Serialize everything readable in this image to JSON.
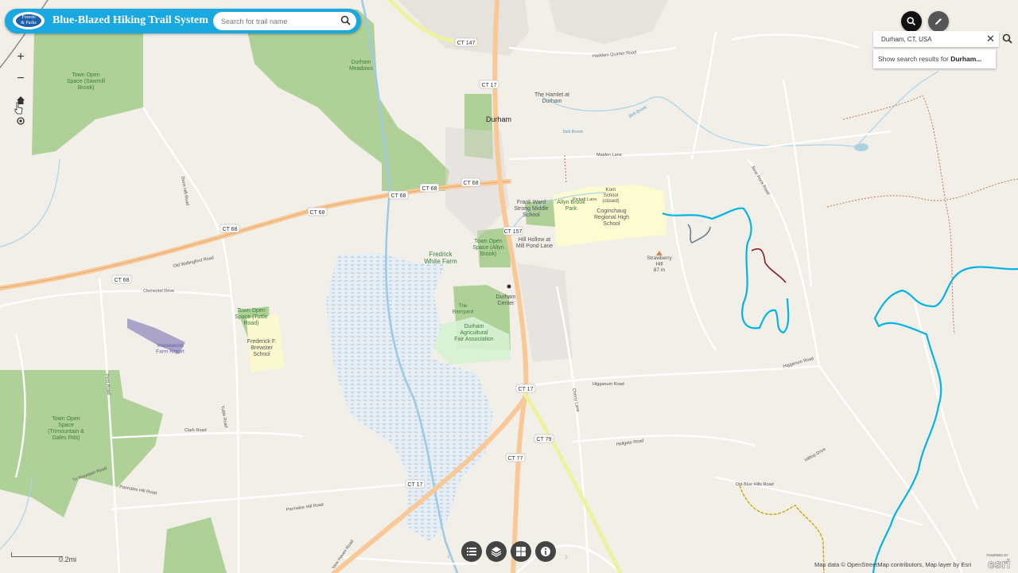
{
  "app": {
    "title": "Blue-Blazed Hiking Trail System",
    "logo_text_1": "Forests",
    "logo_text_2": "& Parks"
  },
  "trail_search": {
    "placeholder": "Search for trail name"
  },
  "map_controls": {
    "zoom_in": "+",
    "zoom_out": "−"
  },
  "geo_search": {
    "value": "Durham, CT, USA",
    "clear": "✕",
    "suggestion_prefix": "Show search results for ",
    "suggestion_term": "Durham..."
  },
  "scale": {
    "label": "0.2mi"
  },
  "attribution": "Map data © OpenStreetMap contributors, Map layer by Esri",
  "esri": {
    "powered": "POWERED BY",
    "brand": "esri"
  },
  "map_labels": {
    "l1": "Durham\nMeadows",
    "l2": "Town Open\nSpace (Sawmill\nBrook)",
    "l3": "Durham",
    "l4": "The Hamlet at\nDurham",
    "l5": "Frank Ward\nStrong Middle\nSchool",
    "l6": "Allyn Brook\nPark",
    "l7": "Korn\nSchool\n(closed)",
    "l8": "Coginchaug\nRegional High\nSchool",
    "l9": "Town Open\nSpace (Allyn\nBrook)",
    "l10": "Hill Hollow at\nMill Pond Lane",
    "l11": "Fredrick\nWhite Farm",
    "l12": "Strawberry\nHill\n87 m",
    "l13": "Durham\nCenter",
    "l14": "The\nBarnyard",
    "l15": "Durham\nAgricultural\nFair Association",
    "l16": "Town Open\nSpace (Tuttle\nRoad)",
    "l17": "Frederick F.\nBrewster\nSchool",
    "l18": "Maplewood\nFarm Airport",
    "l19": "Town Open\nSpace\n(Trimountain &\nGales Rds)",
    "r1": "CT 147",
    "r2": "CT 17",
    "r3": "CT 68",
    "r4": "CT 68",
    "r5": "CT 68",
    "r6": "CT 68",
    "r7": "CT 68",
    "r8": "CT 17",
    "r9": "CT 77",
    "r10": "CT 79",
    "r11": "CT 17",
    "r12": "CT 157",
    "s1": "Maiden Lane",
    "s2": "Higganum Road",
    "s3": "Clark Road",
    "s4": "Parmalee Hill Road",
    "s5": "Old Wallingford Road",
    "s6": "Haddam Quarter Road",
    "s7": "Bear Rock Road",
    "s8": "Pickett Lane",
    "s9": "Hilltop Drive",
    "s10": "Old Blue Hills Road",
    "s11": "Clementel Drive",
    "s12": "Coe Road",
    "s13": "Tri Mountain Road",
    "s14": "Bell Brook",
    "s15": "Dunn Hill Road",
    "s16": "New Haven Road",
    "s17": "Hellgate Road",
    "s18": "Cherry Lane",
    "s19": "Tuttle Road",
    "s20": "Pent Road",
    "s21": "Parmalee Hill Road"
  },
  "trail_colors": {
    "blue_trail": "#00b4e6",
    "dark_trail": "#6b7e8e",
    "red_trail": "#8a1a24",
    "yellow_trail": "#c9a800",
    "brown_trail": "#c07848"
  },
  "toolbar": {
    "list_icon": "list-icon",
    "layers_icon": "layers-icon",
    "basemap_icon": "grid-icon",
    "info_icon": "info-icon"
  }
}
